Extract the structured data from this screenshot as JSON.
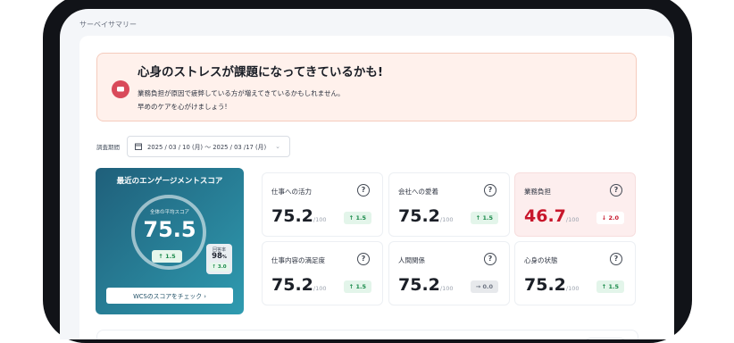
{
  "breadcrumb": "サーベイサマリー",
  "alert": {
    "title": "心身のストレスが課題になってきているかも!",
    "line1": "業務負担が原因で疲弊している方が増えてきているかもしれません。",
    "line2": "早めのケアを心がけましょう!",
    "icon": "chat-bubble-icon"
  },
  "period": {
    "label": "調査期間",
    "value": "2025 / 03 / 10 (月) 〜 2025 / 03 /17 (月)"
  },
  "engagement": {
    "title": "最近のエンゲージメントスコア",
    "avg_label": "全体の平均スコア",
    "score": "75.5",
    "delta": "↑ 1.5",
    "response_label": "回答率",
    "response_value": "98",
    "response_unit": "%",
    "response_delta": "↑ 3.0",
    "button": "WCSのスコアをチェック ›"
  },
  "metrics": [
    {
      "label": "仕事への活力",
      "value": "75.2",
      "unit": "/100",
      "delta": "↑ 1.5"
    },
    {
      "label": "会社への愛着",
      "value": "75.2",
      "unit": "/100",
      "delta": "↑ 1.5"
    },
    {
      "label": "業務負担",
      "value": "46.7",
      "unit": "/100",
      "delta": "↓ 2.0"
    },
    {
      "label": "仕事内容の満足度",
      "value": "75.2",
      "unit": "/100",
      "delta": "↑ 1.5"
    },
    {
      "label": "人間関係",
      "value": "75.2",
      "unit": "/100",
      "delta": "→ 0.0"
    },
    {
      "label": "心身の状態",
      "value": "75.2",
      "unit": "/100",
      "delta": "↑ 1.5"
    }
  ],
  "help_glyph": "?",
  "colors": {
    "accent": "#2f9bb0",
    "danger": "#c8162b",
    "positive": "#1a8a4a",
    "alert_bg": "#fff1ec"
  }
}
